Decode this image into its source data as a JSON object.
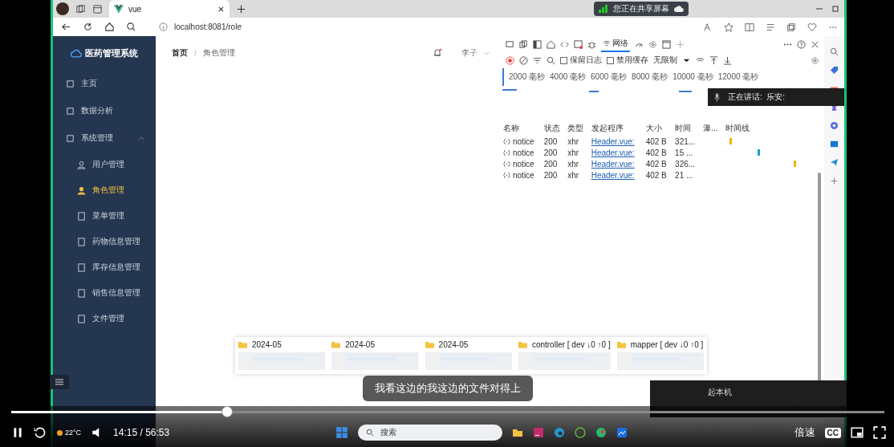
{
  "browser": {
    "tab_title": "vue",
    "url": "localhost:8081/role",
    "sharing_banner": "您正在共享屏幕"
  },
  "app": {
    "logo": "医药管理系统",
    "breadcrumb": [
      "首页",
      "角色管理"
    ],
    "breadcrumb_separator": "/",
    "notification_dot": true,
    "user": "李子"
  },
  "sidebar": {
    "items": [
      {
        "label": "主页",
        "selected": false
      },
      {
        "label": "数据分析",
        "selected": false
      },
      {
        "label": "系统管理",
        "selected": false,
        "expanded": true,
        "children": [
          {
            "label": "用户管理",
            "selected": false
          },
          {
            "label": "角色管理",
            "selected": true
          },
          {
            "label": "菜单管理",
            "selected": false
          },
          {
            "label": "药物信息管理",
            "selected": false
          },
          {
            "label": "库存信息管理",
            "selected": false
          },
          {
            "label": "销售信息管理",
            "selected": false
          },
          {
            "label": "文件管理",
            "selected": false
          }
        ]
      }
    ]
  },
  "devtools": {
    "tabs": [
      {
        "label": "网络",
        "selected": true
      }
    ],
    "checkboxes": [
      {
        "label": "保留日志",
        "checked": false
      },
      {
        "label": "禁用缓存",
        "checked": false
      }
    ],
    "throttle": "无限制",
    "timeline_ticks": [
      "2000 毫秒",
      "4000 毫秒",
      "6000 毫秒",
      "8000 毫秒",
      "10000 毫秒",
      "12000 毫秒"
    ],
    "columns": [
      "名称",
      "状态",
      "类型",
      "发起程序",
      "大小",
      "时间",
      "瀑...",
      "时间线"
    ],
    "rows": [
      {
        "name": "notice",
        "status": "200",
        "type": "xhr",
        "initiator": "Header.vue:",
        "size": "402 B",
        "time": "321..."
      },
      {
        "name": "notice",
        "status": "200",
        "type": "xhr",
        "initiator": "Header.vue:",
        "size": "402 B",
        "time": "15 ..."
      },
      {
        "name": "notice",
        "status": "200",
        "type": "xhr",
        "initiator": "Header.vue:",
        "size": "402 B",
        "time": "326..."
      },
      {
        "name": "notice",
        "status": "200",
        "type": "xhr",
        "initiator": "Header.vue:",
        "size": "402 B",
        "time": "21 ..."
      }
    ]
  },
  "speaking": "正在讲话:  乐安:",
  "thumbnails": [
    {
      "title": "2024-05"
    },
    {
      "title": "2024-05"
    },
    {
      "title": "2024-05"
    },
    {
      "title": "controller [ dev ↓0 ↑0 ]"
    },
    {
      "title": "mapper [ dev ↓0 ↑0 ]"
    }
  ],
  "subtitle": "我看这边的我这边的文件对得上",
  "notification_fragment": "起本机",
  "player": {
    "progress": {
      "level": 0.247
    },
    "time": "14:15 / 56:53",
    "speed": "倍速",
    "captions": "CC"
  },
  "taskbar": {
    "search_placeholder": "搜索",
    "weather": "22°C"
  }
}
